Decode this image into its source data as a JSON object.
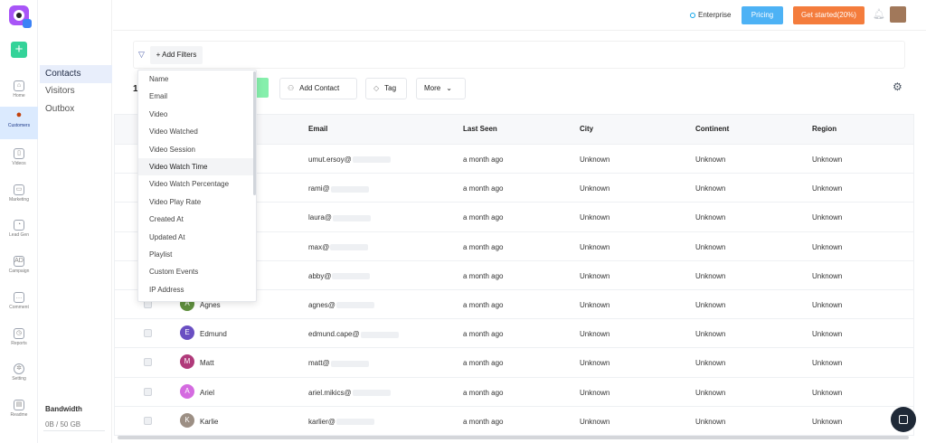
{
  "rail": {
    "items": [
      {
        "label": "Home",
        "icon": "home-icon"
      },
      {
        "label": "Customers",
        "icon": "user-icon"
      },
      {
        "label": "Videos",
        "icon": "video-icon"
      },
      {
        "label": "Marketing",
        "icon": "mail-icon"
      },
      {
        "label": "Lead Gen",
        "icon": "magnet-icon"
      },
      {
        "label": "Campaign",
        "icon": "ad-icon",
        "glyph": "AD"
      },
      {
        "label": "Comment",
        "icon": "comment-icon"
      },
      {
        "label": "Reports",
        "icon": "chart-icon"
      },
      {
        "label": "Setting",
        "icon": "gear-icon"
      },
      {
        "label": "Readme",
        "icon": "book-icon"
      }
    ]
  },
  "submenu": {
    "items": [
      "Contacts",
      "Visitors",
      "Outbox"
    ],
    "bandwidth_title": "Bandwidth",
    "bandwidth_value": "0B / 50 GB"
  },
  "header": {
    "plan": "Enterprise",
    "pricing": "Pricing",
    "get_started": "Get started(20%)"
  },
  "filters": {
    "add_label": "+ Add Filters"
  },
  "toolbar": {
    "count": "1",
    "add_contact": "Add Contact",
    "tag": "Tag",
    "more": "More"
  },
  "dropdown": {
    "items": [
      "Name",
      "Email",
      "Video",
      "Video Watched",
      "Video Session",
      "Video Watch Time",
      "Video Watch Percentage",
      "Video Play Rate",
      "Created At",
      "Updated At",
      "Playlist",
      "Custom Events",
      "IP Address"
    ],
    "highlighted": "Video Watch Time"
  },
  "table": {
    "headers": {
      "email": "Email",
      "last_seen": "Last Seen",
      "city": "City",
      "continent": "Continent",
      "region": "Region"
    },
    "rows": [
      {
        "name": "",
        "initial": "",
        "color": "",
        "email": "umut.ersoy@",
        "last_seen": "a month ago",
        "city": "Unknown",
        "continent": "Unknown",
        "region": "Unknown"
      },
      {
        "name": "",
        "initial": "",
        "color": "",
        "email": "rami@",
        "last_seen": "a month ago",
        "city": "Unknown",
        "continent": "Unknown",
        "region": "Unknown"
      },
      {
        "name": "",
        "initial": "",
        "color": "",
        "email": "laura@",
        "last_seen": "a month ago",
        "city": "Unknown",
        "continent": "Unknown",
        "region": "Unknown"
      },
      {
        "name": "",
        "initial": "",
        "color": "",
        "email": "max@",
        "last_seen": "a month ago",
        "city": "Unknown",
        "continent": "Unknown",
        "region": "Unknown"
      },
      {
        "name": "",
        "initial": "",
        "color": "",
        "email": "abby@",
        "last_seen": "a month ago",
        "city": "Unknown",
        "continent": "Unknown",
        "region": "Unknown"
      },
      {
        "name": "Agnes",
        "initial": "A",
        "color": "#5f8f3e",
        "email": "agnes@",
        "last_seen": "a month ago",
        "city": "Unknown",
        "continent": "Unknown",
        "region": "Unknown"
      },
      {
        "name": "Edmund",
        "initial": "E",
        "color": "#6a4fc2",
        "email": "edmund.cape@",
        "last_seen": "a month ago",
        "city": "Unknown",
        "continent": "Unknown",
        "region": "Unknown"
      },
      {
        "name": "Matt",
        "initial": "M",
        "color": "#b03a7a",
        "email": "matt@",
        "last_seen": "a month ago",
        "city": "Unknown",
        "continent": "Unknown",
        "region": "Unknown"
      },
      {
        "name": "Ariel",
        "initial": "A",
        "color": "#d46be0",
        "email": "ariel.mikics@",
        "last_seen": "a month ago",
        "city": "Unknown",
        "continent": "Unknown",
        "region": "Unknown"
      },
      {
        "name": "Karlie",
        "initial": "K",
        "color": "#9c8f84",
        "email": "karlier@",
        "last_seen": "a month ago",
        "city": "Unknown",
        "continent": "Unknown",
        "region": "Unknown"
      }
    ]
  },
  "colors": {
    "accent_green": "#34d399",
    "pricing_blue": "#4db2f5",
    "start_orange": "#f47c3c",
    "active_bg": "#dbeafe"
  }
}
